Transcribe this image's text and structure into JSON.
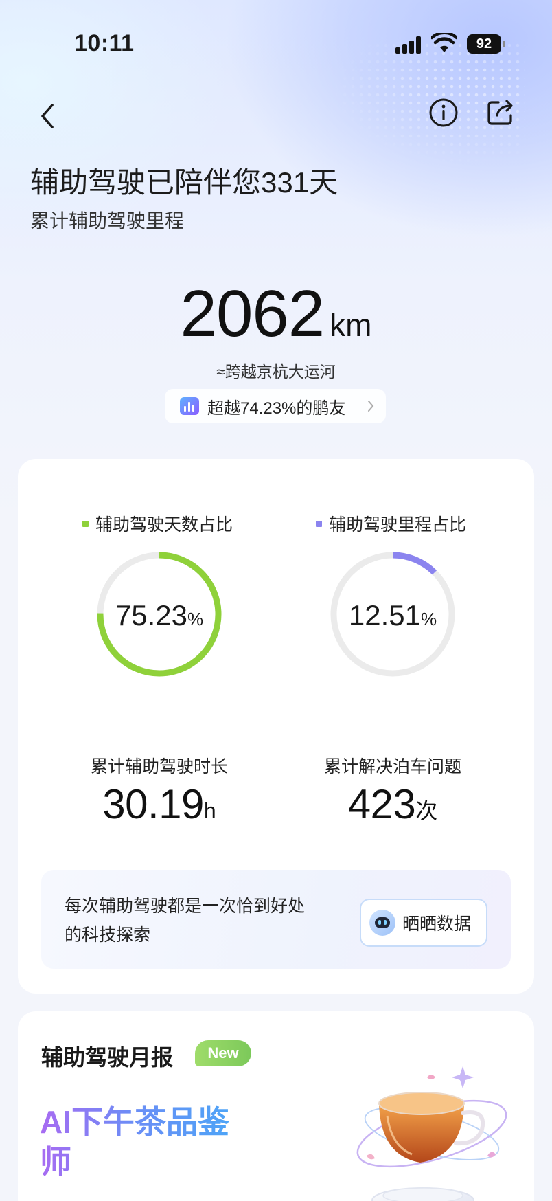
{
  "status_bar": {
    "time": "10:11",
    "battery": "92"
  },
  "header": {
    "headline": "辅助驾驶已陪伴您331天",
    "subline": "累计辅助驾驶里程"
  },
  "mileage": {
    "value": "2062",
    "unit": "km",
    "equivalent": "≈跨越京杭大运河",
    "rank_text": "超越74.23%的鹏友"
  },
  "stats": {
    "days_ratio": {
      "label": "辅助驾驶天数占比",
      "value": "75.23",
      "unit": "%",
      "fraction": 0.7523,
      "color": "#8fd13a"
    },
    "mileage_ratio": {
      "label": "辅助驾驶里程占比",
      "value": "12.51",
      "unit": "%",
      "fraction": 0.1251,
      "color": "#8b84ef"
    },
    "duration": {
      "label": "累计辅助驾驶时长",
      "value": "30.19",
      "unit": "h"
    },
    "parking": {
      "label": "累计解决泊车问题",
      "value": "423",
      "unit": "次"
    }
  },
  "share": {
    "text": "每次辅助驾驶都是一次恰到好处的科技探索",
    "button_label": "晒晒数据"
  },
  "monthly": {
    "title": "辅助驾驶月报",
    "badge": "New",
    "headline": "AI下午茶品鉴师"
  }
}
